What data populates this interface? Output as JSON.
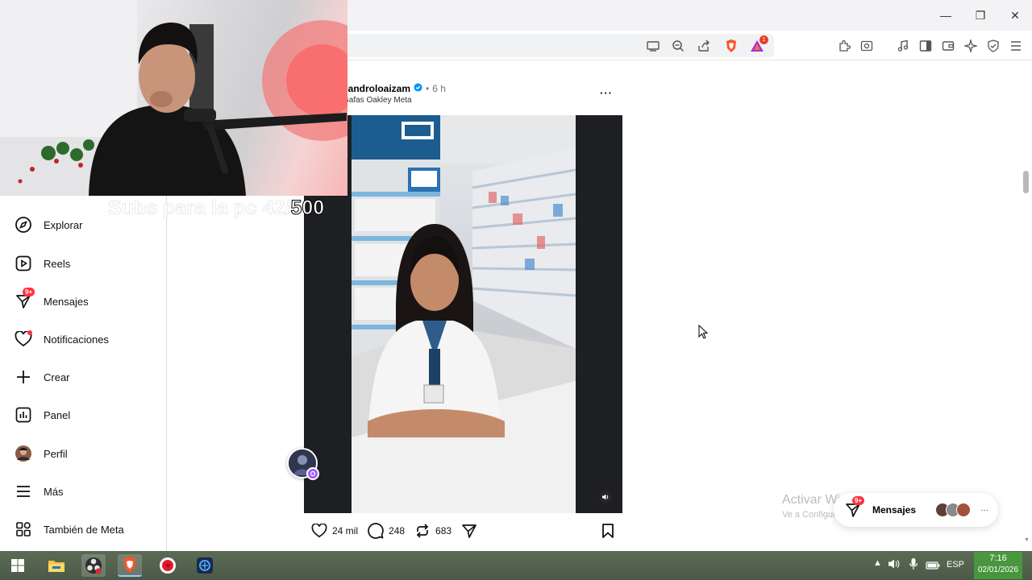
{
  "browser": {
    "window_controls": {
      "minimize": "—",
      "maximize": "❐",
      "close": "✕"
    },
    "shields_badge": "1"
  },
  "sidebar": {
    "items": [
      {
        "label": "Explorar",
        "icon": "compass-icon"
      },
      {
        "label": "Reels",
        "icon": "reels-icon"
      },
      {
        "label": "Mensajes",
        "icon": "messenger-icon",
        "badge": "9+"
      },
      {
        "label": "Notificaciones",
        "icon": "heart-icon"
      },
      {
        "label": "Crear",
        "icon": "plus-icon"
      },
      {
        "label": "Panel",
        "icon": "chart-icon"
      },
      {
        "label": "Perfil",
        "icon": "avatar-icon"
      },
      {
        "label": "Más",
        "icon": "menu-icon"
      },
      {
        "label": "También de Meta",
        "icon": "meta-apps-icon"
      }
    ]
  },
  "post": {
    "username": "eandroloaizam",
    "time": "6 h",
    "subtitle": "Gafas Oakley Meta",
    "likes": "24 mil",
    "comments": "248",
    "reposts": "683",
    "more": "···"
  },
  "stream": {
    "overlay_text": "Subs para la pc 42/",
    "overlay_number": "500"
  },
  "floating_messages": {
    "label": "Mensajes",
    "badge": "9+",
    "more": "···"
  },
  "watermark": {
    "line1": "Activar Windows",
    "line2": "Ve a Configuración para activar Windows."
  },
  "taskbar": {
    "language": "ESP",
    "time": "7:16",
    "date": "02/01/2026"
  },
  "colors": {
    "like_red": "#ff3040",
    "accent": "#0095f6",
    "brave_orange": "#fb542b"
  }
}
